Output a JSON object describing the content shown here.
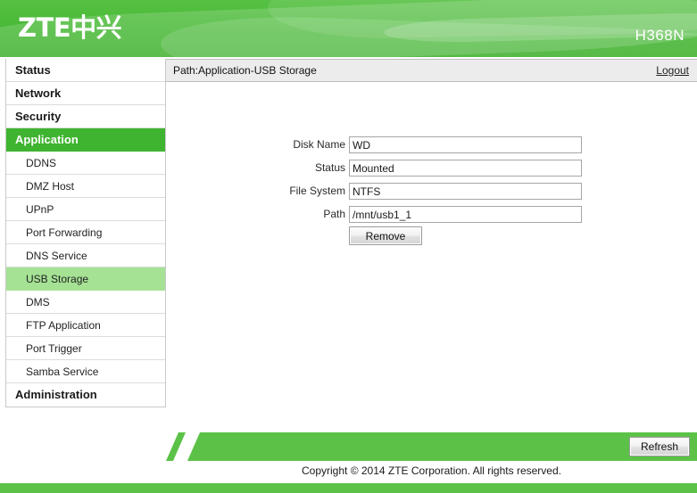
{
  "header": {
    "logo_text": "ZTE中兴",
    "model": "H368N"
  },
  "sidebar": {
    "items": [
      {
        "label": "Status",
        "level": "top",
        "active": false
      },
      {
        "label": "Network",
        "level": "top",
        "active": false
      },
      {
        "label": "Security",
        "level": "top",
        "active": false
      },
      {
        "label": "Application",
        "level": "top",
        "active": true
      },
      {
        "label": "DDNS",
        "level": "sub",
        "active": false
      },
      {
        "label": "DMZ Host",
        "level": "sub",
        "active": false
      },
      {
        "label": "UPnP",
        "level": "sub",
        "active": false
      },
      {
        "label": "Port Forwarding",
        "level": "sub",
        "active": false
      },
      {
        "label": "DNS Service",
        "level": "sub",
        "active": false
      },
      {
        "label": "USB Storage",
        "level": "sub",
        "active": true
      },
      {
        "label": "DMS",
        "level": "sub",
        "active": false
      },
      {
        "label": "FTP Application",
        "level": "sub",
        "active": false
      },
      {
        "label": "Port Trigger",
        "level": "sub",
        "active": false
      },
      {
        "label": "Samba Service",
        "level": "sub",
        "active": false
      },
      {
        "label": "Administration",
        "level": "top",
        "active": false
      }
    ]
  },
  "pathbar": {
    "path": "Path:Application-USB Storage",
    "logout_label": "Logout"
  },
  "form": {
    "fields": [
      {
        "label": "Disk Name",
        "value": "WD"
      },
      {
        "label": "Status",
        "value": "Mounted"
      },
      {
        "label": "File System",
        "value": "NTFS"
      },
      {
        "label": "Path",
        "value": "/mnt/usb1_1"
      }
    ],
    "remove_label": "Remove"
  },
  "footer": {
    "refresh_label": "Refresh",
    "copyright": "Copyright © 2014 ZTE Corporation. All rights reserved."
  },
  "colors": {
    "brand_green": "#4cbb3a",
    "footer_green": "#5cc247",
    "active_nav": "#3fb430",
    "active_sub": "#a5e294"
  }
}
